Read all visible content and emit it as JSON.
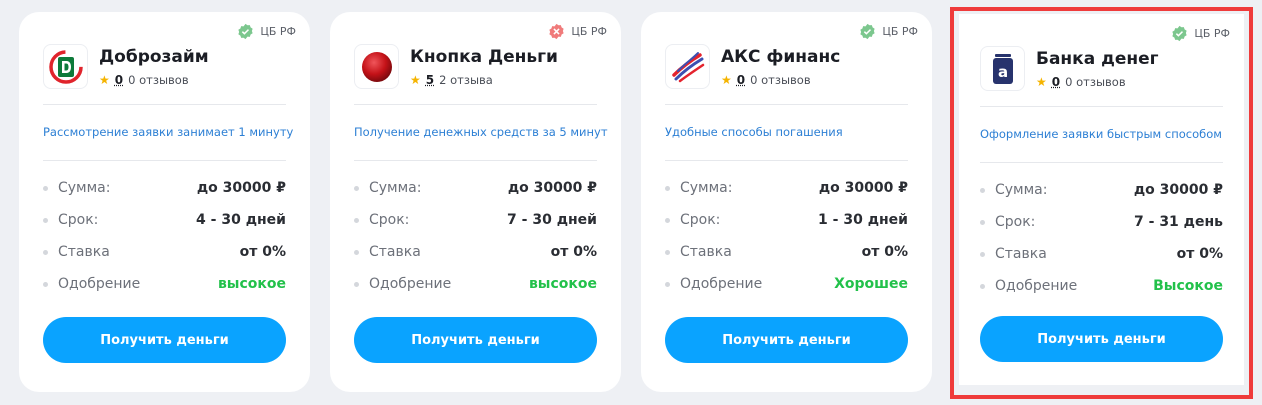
{
  "cards": [
    {
      "cbr_label": "ЦБ РФ",
      "cbr_status": "verified",
      "name": "Доброзайм",
      "score": "0",
      "reviews": "0 отзывов",
      "note": "Рассмотрение заявки занимает 1 минуту",
      "rows": [
        {
          "label": "Сумма:",
          "value": "до 30000 ₽"
        },
        {
          "label": "Срок:",
          "value": "4 - 30 дней"
        },
        {
          "label": "Ставка",
          "value": "от 0%"
        },
        {
          "label": "Одобрение",
          "value": "высокое"
        }
      ],
      "button": "Получить деньги"
    },
    {
      "cbr_label": "ЦБ РФ",
      "cbr_status": "not-verified",
      "name": "Кнопка Деньги",
      "score": "5",
      "reviews": "2 отзыва",
      "note": "Получение денежных средств за 5 минут",
      "rows": [
        {
          "label": "Сумма:",
          "value": "до 30000 ₽"
        },
        {
          "label": "Срок:",
          "value": "7 - 30 дней"
        },
        {
          "label": "Ставка",
          "value": "от 0%"
        },
        {
          "label": "Одобрение",
          "value": "высокое"
        }
      ],
      "button": "Получить деньги"
    },
    {
      "cbr_label": "ЦБ РФ",
      "cbr_status": "verified",
      "name": "АКС финанс",
      "score": "0",
      "reviews": "0 отзывов",
      "note": "Удобные способы погашения",
      "rows": [
        {
          "label": "Сумма:",
          "value": "до 30000 ₽"
        },
        {
          "label": "Срок:",
          "value": "1 - 30 дней"
        },
        {
          "label": "Ставка",
          "value": "от 0%"
        },
        {
          "label": "Одобрение",
          "value": "Хорошее"
        }
      ],
      "button": "Получить деньги"
    },
    {
      "cbr_label": "ЦБ РФ",
      "cbr_status": "verified",
      "name": "Банка денег",
      "score": "0",
      "reviews": "0 отзывов",
      "note": "Оформление заявки быстрым способом",
      "rows": [
        {
          "label": "Сумма:",
          "value": "до 30000 ₽"
        },
        {
          "label": "Срок:",
          "value": "7 - 31 день"
        },
        {
          "label": "Ставка",
          "value": "от 0%"
        },
        {
          "label": "Одобрение",
          "value": "Высокое"
        }
      ],
      "button": "Получить деньги"
    }
  ],
  "icons": {
    "verified": "check-badge-icon",
    "not_verified": "cross-badge-icon",
    "star": "star-icon"
  },
  "colors": {
    "accent": "#0aa3ff",
    "link": "#2c7fd4",
    "approval": "#22c14a",
    "verified": "#7cc78e",
    "not_verified": "#f07b7b",
    "highlight_border": "#ef3b3b"
  }
}
